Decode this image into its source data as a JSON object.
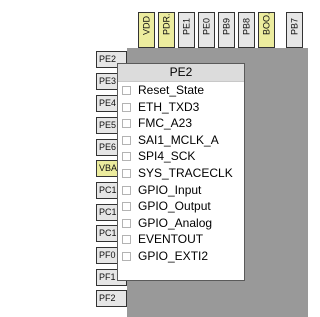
{
  "top_pins": [
    {
      "label": "VDD",
      "color": "#ecec9e"
    },
    {
      "label": "PDR...",
      "color": "#ecec9e"
    },
    {
      "label": "PE1",
      "color": "#e6e6e6"
    },
    {
      "label": "PE0",
      "color": "#e6e6e6"
    },
    {
      "label": "PB9",
      "color": "#e6e6e6"
    },
    {
      "label": "PB8",
      "color": "#e6e6e6"
    },
    {
      "label": "BOO...",
      "color": "#ecec9e"
    },
    {
      "label": "PB7",
      "color": "#e6e6e6"
    }
  ],
  "left_pins": [
    {
      "label": "PE2",
      "color": "#e6e6e6"
    },
    {
      "label": "PE3",
      "color": "#e6e6e6"
    },
    {
      "label": "PE4",
      "color": "#e6e6e6"
    },
    {
      "label": "PE5",
      "color": "#e6e6e6"
    },
    {
      "label": "PE6",
      "color": "#e6e6e6"
    },
    {
      "label": "VBA",
      "color": "#ecec9e"
    },
    {
      "label": "PC1",
      "color": "#e6e6e6"
    },
    {
      "label": "PC1",
      "color": "#e6e6e6"
    },
    {
      "label": "PC1",
      "color": "#e6e6e6"
    },
    {
      "label": "PF0",
      "color": "#e6e6e6"
    },
    {
      "label": "PF1",
      "color": "#e6e6e6"
    },
    {
      "label": "PF2",
      "color": "#e6e6e6"
    }
  ],
  "popup": {
    "title": "PE2",
    "items": [
      "Reset_State",
      "ETH_TXD3",
      "FMC_A23",
      "SAI1_MCLK_A",
      "SPI4_SCK",
      "SYS_TRACECLK",
      "GPIO_Input",
      "GPIO_Output",
      "GPIO_Analog",
      "EVENTOUT",
      "GPIO_EXTI2"
    ]
  }
}
